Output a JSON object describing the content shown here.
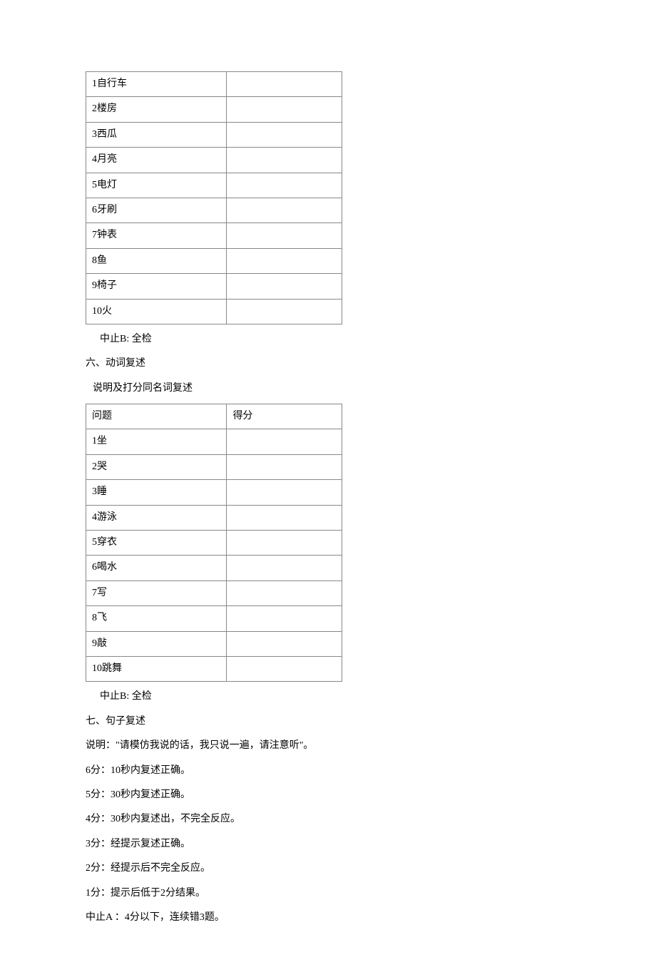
{
  "table1": {
    "rows": [
      {
        "item": "1自行车",
        "score": ""
      },
      {
        "item": "2楼房",
        "score": ""
      },
      {
        "item": "3西瓜",
        "score": ""
      },
      {
        "item": "4月亮",
        "score": ""
      },
      {
        "item": "5电灯",
        "score": ""
      },
      {
        "item": "6牙刷",
        "score": ""
      },
      {
        "item": "7钟表",
        "score": ""
      },
      {
        "item": "8鱼",
        "score": ""
      },
      {
        "item": "9椅子",
        "score": ""
      },
      {
        "item": "10火",
        "score": ""
      }
    ]
  },
  "stop1": "中止B: 全检",
  "section6_title": "六、动词复述",
  "section6_note": "说明及打分同名词复述",
  "table2": {
    "header": {
      "col1": "问题",
      "col2": "得分"
    },
    "rows": [
      {
        "item": "1坐",
        "score": ""
      },
      {
        "item": "2哭",
        "score": ""
      },
      {
        "item": "3睡",
        "score": ""
      },
      {
        "item": "4游泳",
        "score": ""
      },
      {
        "item": "5穿衣",
        "score": ""
      },
      {
        "item": "6喝水",
        "score": ""
      },
      {
        "item": "7写",
        "score": ""
      },
      {
        "item": "8飞",
        "score": ""
      },
      {
        "item": "9敲",
        "score": ""
      },
      {
        "item": "10跳舞",
        "score": ""
      }
    ]
  },
  "stop2": "中止B: 全检",
  "section7_title": "七、句子复述",
  "section7_instruction": "说明：\"请模仿我说的话，我只说一遍，请注意听\"。",
  "scoring": {
    "s6": "6分：10秒内复述正确。",
    "s5": "5分：30秒内复述正确。",
    "s4": "4分：30秒内复述出，不完全反应。",
    "s3": "3分：经提示复述正确。",
    "s2": "2分：经提示后不完全反应。",
    "s1": "1分：提示后低于2分结果。"
  },
  "stopA": "中止A ：4分以下，连续错3题。"
}
